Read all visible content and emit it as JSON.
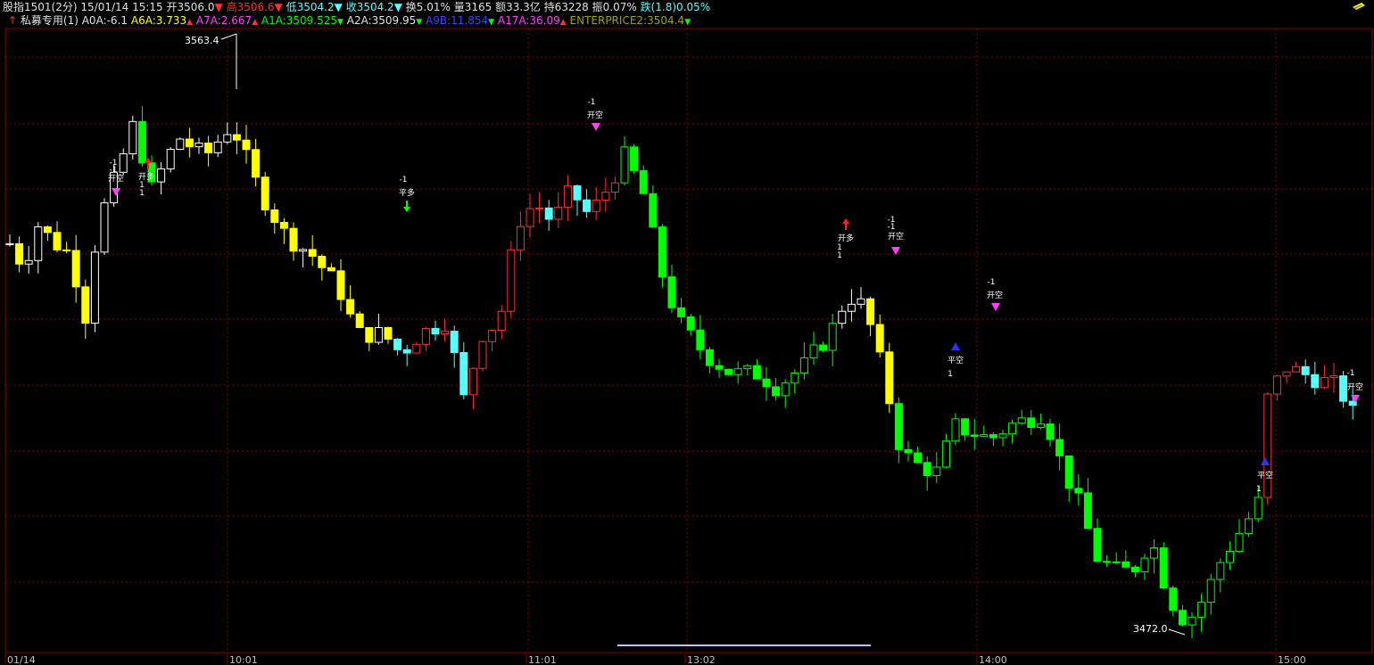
{
  "header": {
    "symbol": "股指1501",
    "period": "(2分)",
    "datetime": "15/01/14 15:15",
    "open_label": "开3506.0",
    "high_label": "高3506.6",
    "low_label": "低3504.2",
    "close_label": "收3504.2",
    "turnover_label": "换5.01%",
    "volume_label": "量3165",
    "amount_label": "额33.3亿",
    "oi_label": "持63228",
    "amp_label": "振0.07%",
    "change_label": "跌(1.8)0.05%"
  },
  "indicator": {
    "name": "私募专用(1)",
    "items": [
      {
        "text": "A0A:-6.1",
        "color": "#e0e0e0",
        "arrow": ""
      },
      {
        "text": "A6A:3.733",
        "color": "#ffff00",
        "arrow": "▲"
      },
      {
        "text": "A7A:2.667",
        "color": "#ff40ff",
        "arrow": "▲"
      },
      {
        "text": "A1A:3509.525",
        "color": "#00ff00",
        "arrow": "▼"
      },
      {
        "text": "A2A:3509.95",
        "color": "#e0e0e0",
        "arrow": "▼"
      },
      {
        "text": "A9B:11.854",
        "color": "#4040ff",
        "arrow": "▼"
      },
      {
        "text": "A17A:36.09",
        "color": "#ff40ff",
        "arrow": "▲"
      },
      {
        "text": "ENTERPRICE2:3504.4",
        "color": "#a0a000",
        "arrow": "▼"
      }
    ]
  },
  "x_labels": [
    {
      "text": "01/14"
    },
    {
      "text": "10:01"
    },
    {
      "text": "11:01"
    },
    {
      "text": "13:02"
    },
    {
      "text": "14:00"
    },
    {
      "text": "15:00"
    }
  ],
  "extremes": {
    "high_label": "3563.4",
    "low_label": "3472.0"
  },
  "signal_labels": {
    "open_short": "开空",
    "close_short": "平空",
    "open_long": "开多",
    "close_long": "平多",
    "minus_one": "-1",
    "plus_one": "1"
  },
  "chart_data": {
    "type": "candlestick",
    "high": 3563.4,
    "low": 3472.0,
    "colors": {
      "up": "#ff3030",
      "down": "#00ff00",
      "yellow": "#ffff00",
      "cyan": "#54ffff",
      "white": "#ffffff",
      "grid": "#8a0000"
    }
  }
}
